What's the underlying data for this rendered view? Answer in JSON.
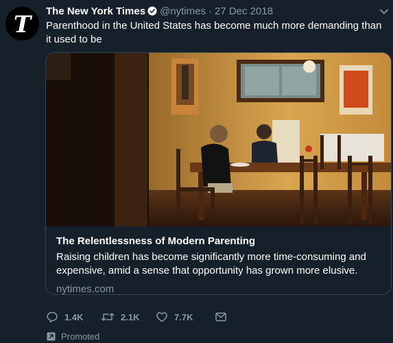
{
  "tweet": {
    "author_name": "The New York Times",
    "handle": "@nytimes",
    "separator": "·",
    "date": "27 Dec 2018",
    "verified": true,
    "text": "Parenthood in the United States has become much more demanding than it used to be",
    "avatar_icon": "nyt-logo-icon",
    "menu_icon": "chevron-down-icon"
  },
  "card": {
    "title": "The Relentlessness of Modern Parenting",
    "description": "Raising children has become significantly more time-consuming and expensive, amid a sense that opportunity has grown more elusive.",
    "domain": "nytimes.com",
    "image_icon": "family-dinner-photo"
  },
  "actions": {
    "reply_count": "1.4K",
    "retweet_count": "2.1K",
    "like_count": "7.7K"
  },
  "promoted": {
    "label": "Promoted",
    "icon": "promoted-arrow-icon"
  },
  "colors": {
    "background": "#15202b",
    "secondary_text": "#8899a6",
    "verified_badge": "#ffffff",
    "border": "#38444d"
  }
}
